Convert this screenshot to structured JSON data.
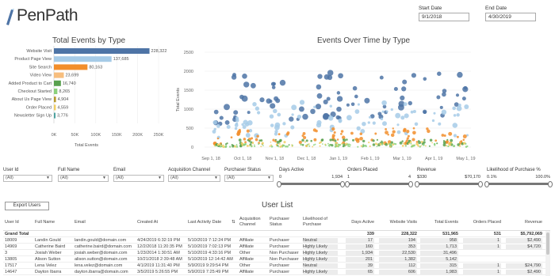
{
  "brand": {
    "name": "PenPath"
  },
  "dates": {
    "start_label": "Start Date",
    "start_value": "9/1/2018",
    "end_label": "End Date",
    "end_value": "4/30/2019"
  },
  "titles": {
    "bar_chart": "Total Events by Type",
    "scatter": "Events Over Time by Type",
    "user_list": "User List"
  },
  "chart_data": [
    {
      "type": "bar",
      "title": "Total Events by Type",
      "xlabel": "Total Events",
      "categories": [
        "Website Visit",
        "Product Page View",
        "Site Search",
        "Video View",
        "Added Product to Cart",
        "Checkout Started",
        "About Us Page View",
        "Order Placed",
        "Newsletter Sign Up"
      ],
      "values": [
        228322,
        137685,
        80163,
        23699,
        16740,
        8265,
        4904,
        4559,
        3776
      ],
      "labels": [
        "228,322",
        "137,685",
        "80,163",
        "23,699",
        "16,740",
        "8,265",
        "4,904",
        "4,559",
        "3,776"
      ],
      "colors": [
        "#4e74a6",
        "#a6cbe7",
        "#f28e2b",
        "#f7be7e",
        "#59a14f",
        "#8cd17d",
        "#b6992d",
        "#f1ce63",
        "#4ea3a0"
      ],
      "xticks": [
        "0K",
        "50K",
        "100K",
        "150K",
        "200K",
        "250K"
      ],
      "xlim": [
        0,
        250000
      ]
    },
    {
      "type": "scatter",
      "title": "Events Over Time by Type",
      "ylabel": "Total Events",
      "ylim": [
        0,
        2500
      ],
      "yticks": [
        "0",
        "500",
        "1000",
        "1500",
        "2000",
        "2500"
      ],
      "xticks": [
        "Sep 1, 18",
        "Oct 1, 18",
        "Nov 1, 18",
        "Dec 1, 18",
        "Jan 1, 19",
        "Feb 1, 19",
        "Mar 1, 19",
        "Apr 1, 19",
        "May 1, 19"
      ],
      "series_colors": [
        "#4e74a6",
        "#a6cbe7",
        "#f28e2b",
        "#59a14f",
        "#f1ce63",
        "#8cd17d"
      ]
    }
  ],
  "filters": [
    {
      "label": "User Id",
      "value": "(All)"
    },
    {
      "label": "Full Name",
      "value": "(All)"
    },
    {
      "label": "Email",
      "value": "(All)"
    },
    {
      "label": "Acquisition Channel",
      "value": "(All)"
    },
    {
      "label": "Purchaser Status",
      "value": "(All)"
    }
  ],
  "ranges": [
    {
      "label": "Days Active",
      "min": "0",
      "max": "1,934"
    },
    {
      "label": "Orders Placed",
      "min": "1",
      "max": "4"
    },
    {
      "label": "Revenue",
      "min": "$330",
      "max": "$70,170"
    },
    {
      "label": "Likelihood of Purchase %",
      "min": "0.1%",
      "max": "100.0%"
    }
  ],
  "export_label": "Export Users",
  "table": {
    "columns": [
      "User Id",
      "Full Name",
      "Email",
      "Created At",
      "Last Activity Date",
      "Acquisition Channel",
      "Purchaser Status",
      "Likelihood of Purchase",
      "Days Active",
      "Website Visits",
      "Total Events",
      "Orders Placed",
      "Revenue"
    ],
    "total": {
      "label": "Grand Total",
      "days": "339",
      "visits": "228,322",
      "events": "531,965",
      "orders": "531",
      "revenue": "$5,792,069"
    },
    "rows": [
      [
        "18009",
        "Landin Gould",
        "landin.gould@domain.com",
        "4/24/2019 6:32:19 PM",
        "5/10/2019 7:12:24 PM",
        "Affiliate",
        "Purchaser",
        "Neutral",
        "17",
        "194",
        "958",
        "1",
        "$2,490"
      ],
      [
        "14969",
        "Catherine Baird",
        "catherine.baird@domain.com",
        "12/2/2018 11:20:35 PM",
        "5/10/2019 7:02:13 PM",
        "Affiliate",
        "Purchaser",
        "Highly Likely",
        "160",
        "353",
        "1,713",
        "1",
        "$4,720"
      ],
      [
        "3",
        "Josiah Weber",
        "josiah.weber@domain.com",
        "1/23/2014 1:30:51 AM",
        "5/10/2019 4:33:16 PM",
        "Other",
        "Non Purchaser",
        "Highly Likely",
        "1,934",
        "22,530",
        "31,496",
        "",
        ""
      ],
      [
        "13805",
        "Alison Sutton",
        "alison.sutton@domain.com",
        "10/21/2018 2:39:48 AM",
        "5/10/2019 12:14:42 AM",
        "Affiliate",
        "Non Purchaser",
        "Highly Likely",
        "201",
        "1,382",
        "5,142",
        "",
        ""
      ],
      [
        "17517",
        "Lena Velez",
        "lena.velez@domain.com",
        "4/1/2019 11:31:40 PM",
        "5/9/2019 9:29:54 PM",
        "Other",
        "Purchaser",
        "Neutral",
        "39",
        "112",
        "315",
        "1",
        "$24,790"
      ],
      [
        "14647",
        "Dayton Ibarra",
        "dayton.ibarra@domain.com",
        "3/5/2019 5:26:55 PM",
        "5/9/2019 7:25:49 PM",
        "Affiliate",
        "Purchaser",
        "Highly Likely",
        "65",
        "606",
        "1,983",
        "1",
        "$2,490"
      ]
    ]
  }
}
